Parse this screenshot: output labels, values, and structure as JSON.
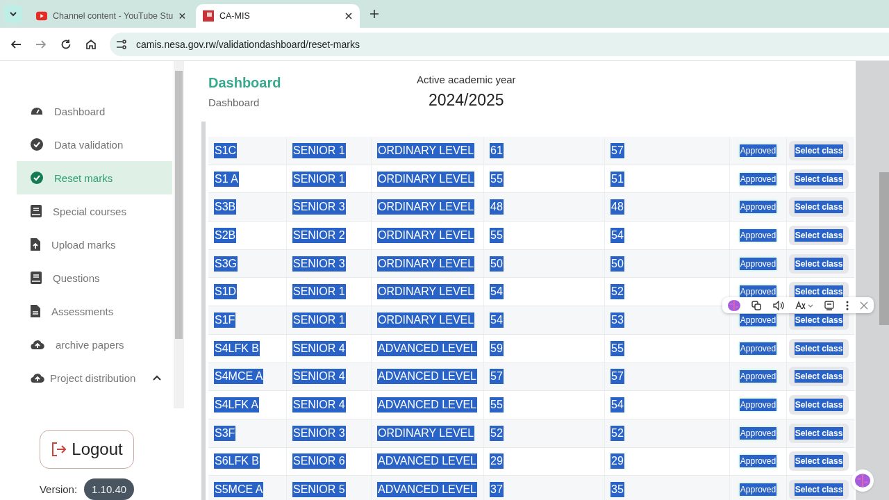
{
  "browser": {
    "tabs": [
      {
        "title": "Channel content - YouTube Stu",
        "selected": false
      },
      {
        "title": "CA-MIS",
        "selected": true
      }
    ],
    "url": "camis.nesa.gov.rw/validationdashboard/reset-marks"
  },
  "sidebar": {
    "items": [
      {
        "label": "Dashboard",
        "selected": false
      },
      {
        "label": "Data validation",
        "selected": false
      },
      {
        "label": "Reset marks",
        "selected": true
      },
      {
        "label": "Special courses",
        "selected": false
      },
      {
        "label": "Upload marks",
        "selected": false
      },
      {
        "label": "Questions",
        "selected": false
      },
      {
        "label": "Assessments",
        "selected": false
      },
      {
        "label": "archive papers",
        "selected": false
      },
      {
        "label": "Project distribution",
        "selected": false,
        "expanded": true
      }
    ],
    "logout": "Logout",
    "version_label": "Version:",
    "version": "1.10.40"
  },
  "header": {
    "title": "Dashboard",
    "breadcrumb": "Dashboard",
    "year_label": "Active academic year",
    "year": "2024/2025"
  },
  "table": {
    "text_selected": true,
    "rows": [
      {
        "cells": [
          "S1C",
          "SENIOR 1",
          "ORDINARY LEVEL",
          "61",
          "57"
        ],
        "status": "Approved",
        "action": "Select class"
      },
      {
        "cells": [
          "S1 A",
          "SENIOR 1",
          "ORDINARY LEVEL",
          "55",
          "51"
        ],
        "status": "Approved",
        "action": "Select class"
      },
      {
        "cells": [
          "S3B",
          "SENIOR 3",
          "ORDINARY LEVEL",
          "48",
          "48"
        ],
        "status": "Approved",
        "action": "Select class"
      },
      {
        "cells": [
          "S2B",
          "SENIOR 2",
          "ORDINARY LEVEL",
          "55",
          "54"
        ],
        "status": "Approved",
        "action": "Select class"
      },
      {
        "cells": [
          "S3G",
          "SENIOR 3",
          "ORDINARY LEVEL",
          "50",
          "50"
        ],
        "status": "Approved",
        "action": "Select class"
      },
      {
        "cells": [
          "S1D",
          "SENIOR 1",
          "ORDINARY LEVEL",
          "54",
          "52"
        ],
        "status": "Approved",
        "action": "Select class"
      },
      {
        "cells": [
          "S1F",
          "SENIOR 1",
          "ORDINARY LEVEL",
          "54",
          "53"
        ],
        "status": "Approved",
        "action": "Select class"
      },
      {
        "cells": [
          "S4LFK B",
          "SENIOR 4",
          "ADVANCED LEVEL",
          "59",
          "55"
        ],
        "status": "Approved",
        "action": "Select class"
      },
      {
        "cells": [
          "S4MCE A",
          "SENIOR 4",
          "ADVANCED LEVEL",
          "57",
          "57"
        ],
        "status": "Approved",
        "action": "Select class"
      },
      {
        "cells": [
          "S4LFK A",
          "SENIOR 4",
          "ADVANCED LEVEL",
          "55",
          "54"
        ],
        "status": "Approved",
        "action": "Select class"
      },
      {
        "cells": [
          "S3F",
          "SENIOR 3",
          "ORDINARY LEVEL",
          "52",
          "52"
        ],
        "status": "Approved",
        "action": "Select class"
      },
      {
        "cells": [
          "S6LFK B",
          "SENIOR 6",
          "ADVANCED LEVEL",
          "29",
          "29"
        ],
        "status": "Approved",
        "action": "Select class"
      },
      {
        "cells": [
          "S5MCE A",
          "SENIOR 5",
          "ADVANCED LEVEL",
          "37",
          "35"
        ],
        "status": "Approved",
        "action": "Select class"
      }
    ]
  }
}
